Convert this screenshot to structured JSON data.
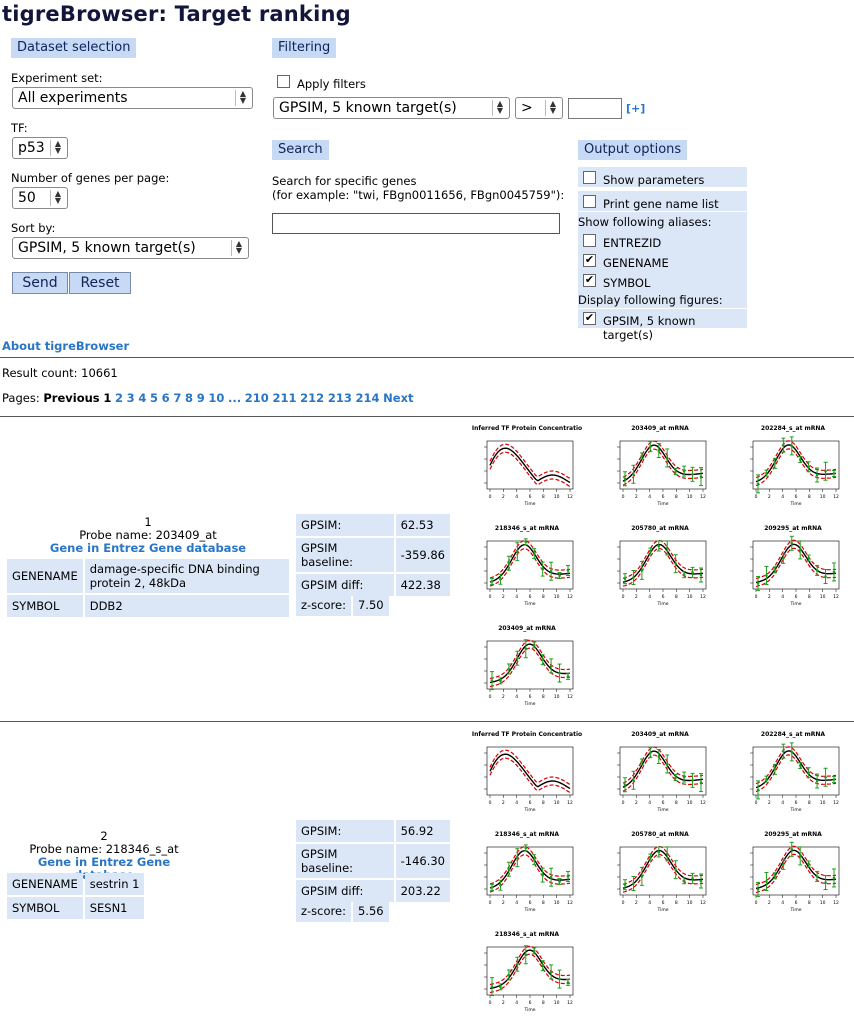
{
  "title": "tigreBrowser: Target ranking",
  "dataset": {
    "header": "Dataset selection",
    "experiment_label": "Experiment set:",
    "experiment_value": "All experiments",
    "tf_label": "TF:",
    "tf_value": "p53",
    "genes_label": "Number of genes per page:",
    "genes_value": "50",
    "sort_label": "Sort by:",
    "sort_value": "GPSIM, 5 known target(s)",
    "send": "Send",
    "reset": "Reset"
  },
  "filtering": {
    "header": "Filtering",
    "apply_label": "Apply filters",
    "filter_field": "GPSIM, 5 known target(s)",
    "operator": ">",
    "value": "",
    "add": "[+]"
  },
  "search": {
    "header": "Search",
    "label1": "Search for specific genes",
    "label2": "(for example: \"twi, FBgn0011656, FBgn0045759\"):",
    "value": ""
  },
  "output": {
    "header": "Output options",
    "show_parameters": "Show parameters",
    "print_gene_list": "Print gene name list",
    "aliases_label": "Show following aliases:",
    "aliases": [
      {
        "label": "ENTREZID",
        "checked": false
      },
      {
        "label": "GENENAME",
        "checked": true
      },
      {
        "label": "SYMBOL",
        "checked": true
      }
    ],
    "figures_label": "Display following figures:",
    "figure": {
      "label": "GPSIM, 5 known target(s)",
      "checked": true
    }
  },
  "about": "About tigreBrowser",
  "result_count": "Result count: 10661",
  "pages": {
    "label": "Pages:",
    "previous": "Previous",
    "current": "1",
    "numbers": [
      "2",
      "3",
      "4",
      "5",
      "6",
      "7",
      "8",
      "9",
      "10",
      "...",
      "210",
      "211",
      "212",
      "213",
      "214"
    ],
    "next": "Next"
  },
  "plot_titles": [
    "Inferred TF Protein Concentratio",
    "203409_at mRNA",
    "202284_s_at mRNA",
    "218346_s_at mRNA",
    "205780_at mRNA",
    "209295_at mRNA"
  ],
  "results": [
    {
      "rank": "1",
      "probe": "Probe name: 203409_at",
      "entrez_link": "Gene in Entrez Gene database",
      "genename_key": "GENENAME",
      "genename": "damage-specific DNA binding protein 2, 48kDa",
      "symbol_key": "SYMBOL",
      "symbol": "DDB2",
      "gpsim_label": "GPSIM:",
      "gpsim": "62.53",
      "baseline_label": "GPSIM baseline:",
      "baseline": "-359.86",
      "diff_label": "GPSIM diff:",
      "diff": "422.38",
      "z_label": "z-score:",
      "z": "7.50",
      "extra_plot": "203409_at mRNA"
    },
    {
      "rank": "2",
      "probe": "Probe name: 218346_s_at",
      "entrez_link": "Gene in Entrez Gene database",
      "genename_key": "GENENAME",
      "genename": "sestrin 1",
      "symbol_key": "SYMBOL",
      "symbol": "SESN1",
      "gpsim_label": "GPSIM:",
      "gpsim": "56.92",
      "baseline_label": "GPSIM baseline:",
      "baseline": "-146.30",
      "diff_label": "GPSIM diff:",
      "diff": "203.22",
      "z_label": "z-score:",
      "z": "5.56",
      "extra_plot": "218346_s_at mRNA"
    }
  ]
}
